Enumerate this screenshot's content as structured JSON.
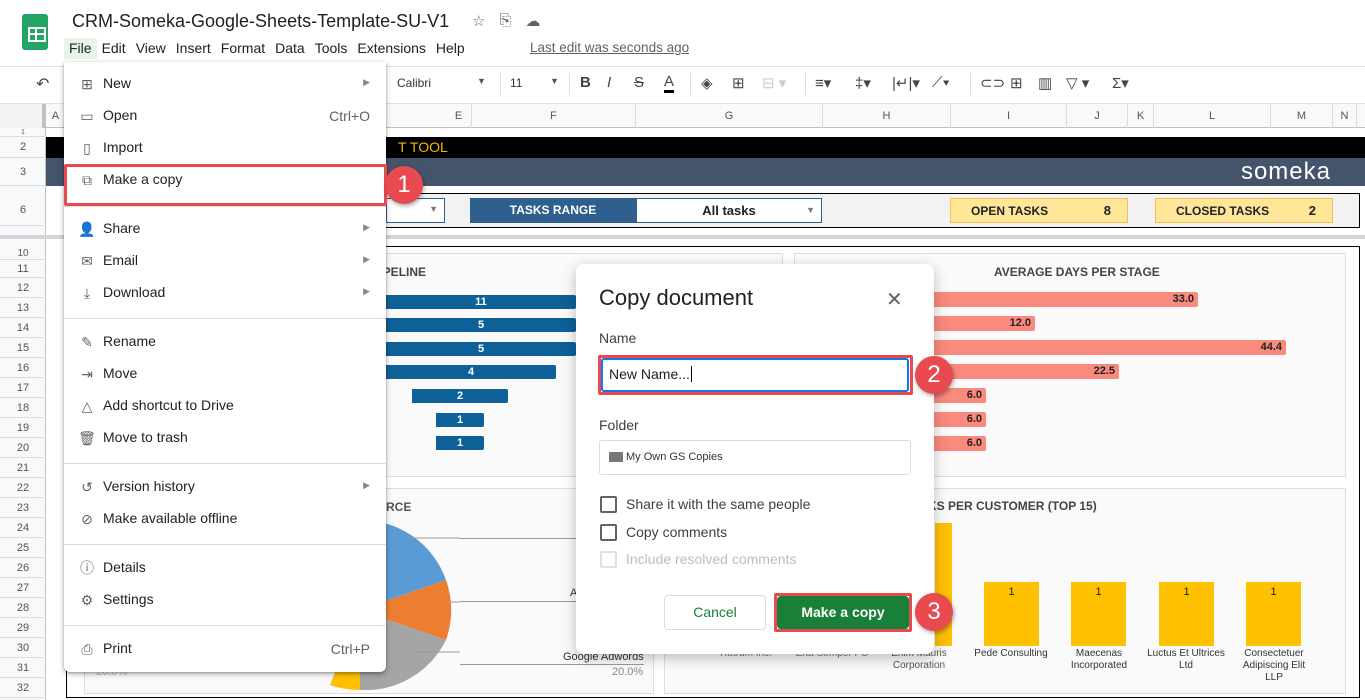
{
  "header": {
    "title": "CRM-Someka-Google-Sheets-Template-SU-V1",
    "title_icons": [
      "star-icon",
      "move-to-folder-icon",
      "cloud-saved-icon"
    ],
    "menu": [
      "File",
      "Edit",
      "View",
      "Insert",
      "Format",
      "Data",
      "Tools",
      "Extensions",
      "Help"
    ],
    "last_edit": "Last edit was seconds ago"
  },
  "toolbar": {
    "font": "Calibri",
    "font_size": "11",
    "items": [
      "B",
      "I",
      "S",
      "A"
    ]
  },
  "columns": [
    "A",
    "E",
    "F",
    "G",
    "H",
    "I",
    "J",
    "K",
    "L",
    "M",
    "N"
  ],
  "rows": [
    "1",
    "2",
    "3",
    "6",
    "10",
    "11",
    "12",
    "13",
    "14",
    "15",
    "16",
    "17",
    "18",
    "19",
    "20",
    "21",
    "22",
    "23",
    "24",
    "25",
    "26",
    "27",
    "28",
    "29",
    "30",
    "31",
    "32"
  ],
  "sheet": {
    "title_fragment": "T TOOL",
    "brand": "someka",
    "tasks_range_label": "TASKS RANGE",
    "tasks_range_value": "All tasks",
    "open_tasks_label": "OPEN TASKS",
    "open_tasks_value": "8",
    "closed_tasks_label": "CLOSED TASKS",
    "closed_tasks_value": "2"
  },
  "file_menu": {
    "groups": [
      [
        {
          "label": "New",
          "icon": "new-icon",
          "submenu": true
        },
        {
          "label": "Open",
          "icon": "folder-open-icon",
          "shortcut": "Ctrl+O"
        },
        {
          "label": "Import",
          "icon": "import-file-icon"
        },
        {
          "label": "Make a copy",
          "icon": "copy-icon",
          "highlighted": true
        }
      ],
      [
        {
          "label": "Share",
          "icon": "share-person-icon",
          "submenu": true
        },
        {
          "label": "Email",
          "icon": "email-icon",
          "submenu": true
        },
        {
          "label": "Download",
          "icon": "download-icon",
          "submenu": true
        }
      ],
      [
        {
          "label": "Rename",
          "icon": "rename-icon"
        },
        {
          "label": "Move",
          "icon": "move-icon"
        },
        {
          "label": "Add shortcut to Drive",
          "icon": "drive-shortcut-icon"
        },
        {
          "label": "Move to trash",
          "icon": "trash-icon"
        }
      ],
      [
        {
          "label": "Version history",
          "icon": "history-icon",
          "submenu": true
        },
        {
          "label": "Make available offline",
          "icon": "offline-icon"
        }
      ],
      [
        {
          "label": "Details",
          "icon": "info-icon"
        },
        {
          "label": "Settings",
          "icon": "gear-icon"
        }
      ],
      [
        {
          "label": "Print",
          "icon": "print-icon",
          "shortcut": "Ctrl+P"
        }
      ]
    ]
  },
  "dialog": {
    "title": "Copy document",
    "name_label": "Name",
    "name_value": "New Name...",
    "folder_label": "Folder",
    "folder_value": "My Own GS Copies",
    "checkboxes": [
      {
        "label": "Share it with the same people",
        "checked": false,
        "disabled": false
      },
      {
        "label": "Copy comments",
        "checked": false,
        "disabled": false
      },
      {
        "label": "Include resolved comments",
        "checked": false,
        "disabled": true
      }
    ],
    "cancel_label": "Cancel",
    "confirm_label": "Make a copy"
  },
  "annotations": [
    "1",
    "2",
    "3"
  ],
  "charts": {
    "pipeline": {
      "title": "SALES PIPELINE",
      "values": [
        11,
        5,
        5,
        4,
        2,
        1,
        1
      ]
    },
    "avg_days": {
      "title": "AVERAGE DAYS PER STAGE",
      "values": [
        "33.0",
        "12.0",
        "44.4",
        "22.5",
        "6.0",
        "6.0",
        "6.0"
      ]
    },
    "source": {
      "title_fragment": "RCE",
      "label": "Google Adwords",
      "pct": "20.0%",
      "pct_left": "20.0%",
      "label_fragment": "A"
    },
    "customers": {
      "title_fragment": "KS PER CUSTOMER (TOP 15)",
      "bars": [
        {
          "name": "Pede Consulting",
          "value": "1"
        },
        {
          "name": "Maecenas Incorporated",
          "value": "1"
        },
        {
          "name": "Luctus Et Ultrices Ltd",
          "value": "1"
        },
        {
          "name": "Consectetuer Adipiscing Elit LLP",
          "value": "1"
        }
      ],
      "hidden_labels": [
        "Rutrum Inc.",
        "Erat Semper PC",
        "Enim Mauris Corporation"
      ]
    }
  }
}
